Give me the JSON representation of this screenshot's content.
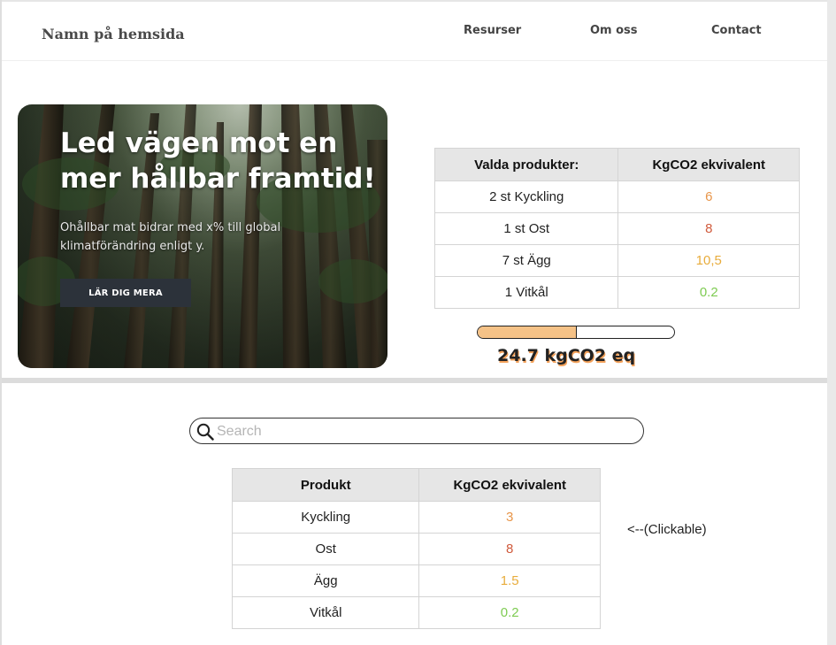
{
  "header": {
    "brand": "Namn på hemsida",
    "nav": [
      "Resurser",
      "Om oss",
      "Contact"
    ]
  },
  "hero": {
    "title": "Led vägen mot en mer hållbar framtid!",
    "text": "Ohållbar mat bidrar med x% till global klimatförändring enligt y.",
    "button": "LÄR DIG MERA"
  },
  "selected": {
    "headers": [
      "Valda produkter:",
      "KgCO2 ekvivalent"
    ],
    "rows": [
      {
        "product": "2 st Kyckling",
        "value": "6",
        "color": "#e8964a"
      },
      {
        "product": "1 st Ost",
        "value": "8",
        "color": "#d05a3c"
      },
      {
        "product": "7 st Ägg",
        "value": "10,5",
        "color": "#e8ac3c"
      },
      {
        "product": "1 Vitkål",
        "value": "0.2",
        "color": "#7ecb52"
      }
    ],
    "progress_fraction": 0.5,
    "progress_color": "#f5c287",
    "total": "24.7 kgCO2 eq"
  },
  "search": {
    "placeholder": "Search",
    "icon": "search-icon"
  },
  "products": {
    "headers": [
      "Produkt",
      "KgCO2 ekvivalent"
    ],
    "rows": [
      {
        "product": "Kyckling",
        "value": "3",
        "color": "#e8964a"
      },
      {
        "product": "Ost",
        "value": "8",
        "color": "#d05a3c"
      },
      {
        "product": "Ägg",
        "value": "1.5",
        "color": "#e8ac3c"
      },
      {
        "product": "Vitkål",
        "value": "0.2",
        "color": "#7ecb52"
      }
    ],
    "hint": "<--(Clickable)"
  }
}
